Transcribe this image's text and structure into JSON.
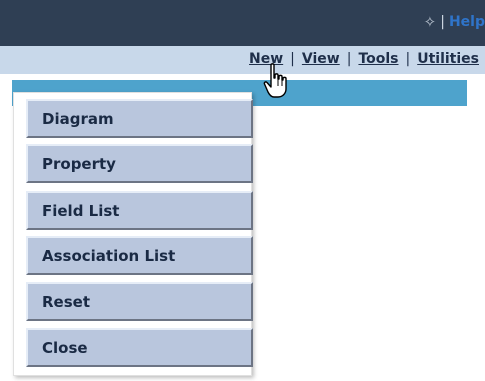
{
  "topbar": {
    "help_label": "Help"
  },
  "menubar": {
    "items": [
      "New",
      "View",
      "Tools",
      "Utilities"
    ],
    "separator": "|"
  },
  "dropdown": {
    "items": [
      "Diagram",
      "Property",
      "Field List",
      "Association List",
      "Reset",
      "Close"
    ]
  }
}
